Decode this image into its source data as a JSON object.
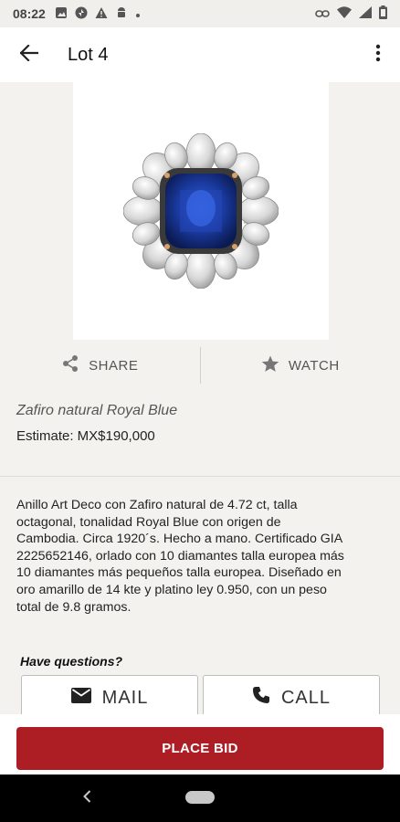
{
  "status_bar": {
    "time": "08:22",
    "icons": [
      "gallery-icon",
      "pinwheel-icon",
      "warning-icon",
      "android-icon",
      "dot-icon",
      "link-icon",
      "wifi-icon",
      "battery-icon"
    ]
  },
  "app_bar": {
    "title": "Lot 4",
    "back_icon": "arrow-back-icon",
    "overflow_icon": "more-vertical-icon"
  },
  "lot": {
    "image_alt": "Sapphire and diamond ring",
    "share_label": "SHARE",
    "watch_label": "WATCH",
    "title": "Zafiro natural Royal Blue",
    "estimate": "Estimate: MX$190,000",
    "description_lines": [
      "Anillo Art Deco con Zafiro natural de 4.72 ct, talla",
      "octagonal, tonalidad Royal Blue con origen de",
      "Cambodia. Circa 1920´s. Hecho a mano. Certificado GIA",
      "2225652146, orlado con 10 diamantes talla europea más",
      "10 diamantes más pequeños talla europea. Diseñado en",
      "oro amarillo de 14 kte y platino ley 0.950, con un peso",
      "total de 9.8 gramos."
    ]
  },
  "contact": {
    "heading": "Have questions?",
    "mail_label": "MAIL",
    "call_label": "CALL"
  },
  "footer": {
    "place_bid_label": "PLACE BID",
    "accent_color": "#ad1e24"
  }
}
